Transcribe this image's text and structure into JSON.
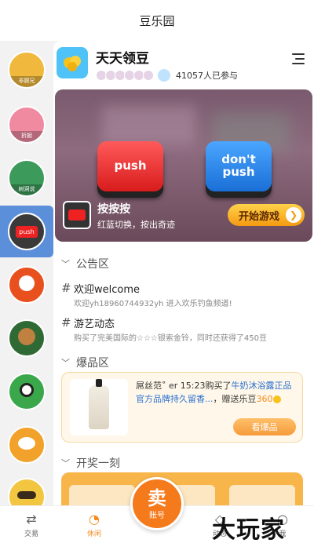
{
  "header": {
    "title": "豆乐园"
  },
  "sidebar": {
    "items": [
      {
        "tag": "非顾兄",
        "color": "#f0b83c"
      },
      {
        "tag": "折掘",
        "color": "#f08aa0"
      },
      {
        "tag": "树洞说",
        "color": "#3c9a5a"
      },
      {
        "tag": "push",
        "color": "#3a3a3a"
      },
      {
        "tag": "",
        "color": "#e8501e"
      },
      {
        "tag": "",
        "color": "#2f6a35"
      },
      {
        "tag": "",
        "color": "#3aa84a"
      },
      {
        "tag": "",
        "color": "#f2a22a"
      },
      {
        "tag": "",
        "color": "#f2c640"
      }
    ]
  },
  "game": {
    "title": "天天领豆",
    "participants": "41057人已参与",
    "banner": {
      "red_button": "push",
      "blue_button_line1": "don't",
      "blue_button_line2": "push",
      "name": "按按按",
      "desc": "红蓝切换，按出奇迹",
      "start_label": "开始游戏",
      "start_arrow": "❯"
    }
  },
  "notice": {
    "heading": "公告区",
    "items": [
      {
        "title": "欢迎welcome",
        "text": "欢迎yh18960744932yh 进入欢乐钓鱼频道!"
      },
      {
        "title": "游艺动态",
        "text": "购买了完美国际的☆☆☆银索金铃，同时还获得了450豆"
      }
    ]
  },
  "hot": {
    "heading": "爆品区",
    "user": "屌丝范˚ er",
    "time": "15:23购买了",
    "product": "牛奶沐浴露正品官方品牌持久留香...",
    "reward_prefix": "，赠送乐豆",
    "reward": "360",
    "button": "看爆品"
  },
  "lottery": {
    "heading": "开奖一刻"
  },
  "tabs": {
    "trade": "交易",
    "leisure": "休闲",
    "sell_big": "卖",
    "sell_small": "账号",
    "feed": "动态",
    "me": "我"
  },
  "watermark": "大玩家",
  "colors": {
    "accent": "#f28a1e",
    "sidebar_active": "#5b8fd9",
    "link": "#2b6fd0"
  }
}
